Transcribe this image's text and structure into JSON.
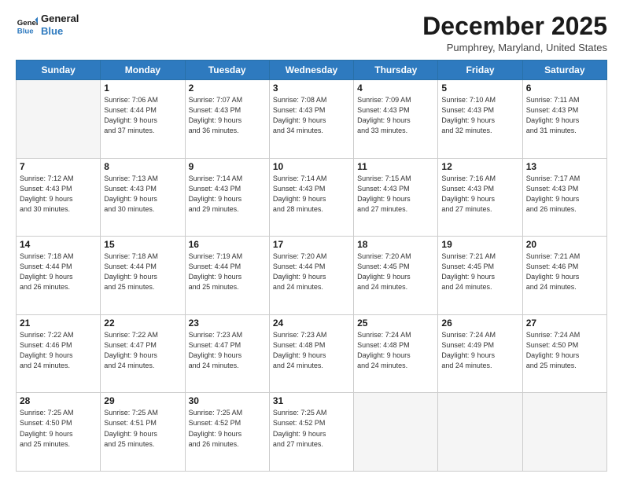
{
  "header": {
    "logo_line1": "General",
    "logo_line2": "Blue",
    "month": "December 2025",
    "location": "Pumphrey, Maryland, United States"
  },
  "days": [
    "Sunday",
    "Monday",
    "Tuesday",
    "Wednesday",
    "Thursday",
    "Friday",
    "Saturday"
  ],
  "weeks": [
    [
      {
        "day": "",
        "empty": true
      },
      {
        "day": "1",
        "sunrise": "7:06 AM",
        "sunset": "4:44 PM",
        "daylight": "9 hours and 37 minutes."
      },
      {
        "day": "2",
        "sunrise": "7:07 AM",
        "sunset": "4:43 PM",
        "daylight": "9 hours and 36 minutes."
      },
      {
        "day": "3",
        "sunrise": "7:08 AM",
        "sunset": "4:43 PM",
        "daylight": "9 hours and 34 minutes."
      },
      {
        "day": "4",
        "sunrise": "7:09 AM",
        "sunset": "4:43 PM",
        "daylight": "9 hours and 33 minutes."
      },
      {
        "day": "5",
        "sunrise": "7:10 AM",
        "sunset": "4:43 PM",
        "daylight": "9 hours and 32 minutes."
      },
      {
        "day": "6",
        "sunrise": "7:11 AM",
        "sunset": "4:43 PM",
        "daylight": "9 hours and 31 minutes."
      }
    ],
    [
      {
        "day": "7",
        "sunrise": "7:12 AM",
        "sunset": "4:43 PM",
        "daylight": "9 hours and 30 minutes."
      },
      {
        "day": "8",
        "sunrise": "7:13 AM",
        "sunset": "4:43 PM",
        "daylight": "9 hours and 30 minutes."
      },
      {
        "day": "9",
        "sunrise": "7:14 AM",
        "sunset": "4:43 PM",
        "daylight": "9 hours and 29 minutes."
      },
      {
        "day": "10",
        "sunrise": "7:14 AM",
        "sunset": "4:43 PM",
        "daylight": "9 hours and 28 minutes."
      },
      {
        "day": "11",
        "sunrise": "7:15 AM",
        "sunset": "4:43 PM",
        "daylight": "9 hours and 27 minutes."
      },
      {
        "day": "12",
        "sunrise": "7:16 AM",
        "sunset": "4:43 PM",
        "daylight": "9 hours and 27 minutes."
      },
      {
        "day": "13",
        "sunrise": "7:17 AM",
        "sunset": "4:43 PM",
        "daylight": "9 hours and 26 minutes."
      }
    ],
    [
      {
        "day": "14",
        "sunrise": "7:18 AM",
        "sunset": "4:44 PM",
        "daylight": "9 hours and 26 minutes."
      },
      {
        "day": "15",
        "sunrise": "7:18 AM",
        "sunset": "4:44 PM",
        "daylight": "9 hours and 25 minutes."
      },
      {
        "day": "16",
        "sunrise": "7:19 AM",
        "sunset": "4:44 PM",
        "daylight": "9 hours and 25 minutes."
      },
      {
        "day": "17",
        "sunrise": "7:20 AM",
        "sunset": "4:44 PM",
        "daylight": "9 hours and 24 minutes."
      },
      {
        "day": "18",
        "sunrise": "7:20 AM",
        "sunset": "4:45 PM",
        "daylight": "9 hours and 24 minutes."
      },
      {
        "day": "19",
        "sunrise": "7:21 AM",
        "sunset": "4:45 PM",
        "daylight": "9 hours and 24 minutes."
      },
      {
        "day": "20",
        "sunrise": "7:21 AM",
        "sunset": "4:46 PM",
        "daylight": "9 hours and 24 minutes."
      }
    ],
    [
      {
        "day": "21",
        "sunrise": "7:22 AM",
        "sunset": "4:46 PM",
        "daylight": "9 hours and 24 minutes."
      },
      {
        "day": "22",
        "sunrise": "7:22 AM",
        "sunset": "4:47 PM",
        "daylight": "9 hours and 24 minutes."
      },
      {
        "day": "23",
        "sunrise": "7:23 AM",
        "sunset": "4:47 PM",
        "daylight": "9 hours and 24 minutes."
      },
      {
        "day": "24",
        "sunrise": "7:23 AM",
        "sunset": "4:48 PM",
        "daylight": "9 hours and 24 minutes."
      },
      {
        "day": "25",
        "sunrise": "7:24 AM",
        "sunset": "4:48 PM",
        "daylight": "9 hours and 24 minutes."
      },
      {
        "day": "26",
        "sunrise": "7:24 AM",
        "sunset": "4:49 PM",
        "daylight": "9 hours and 24 minutes."
      },
      {
        "day": "27",
        "sunrise": "7:24 AM",
        "sunset": "4:50 PM",
        "daylight": "9 hours and 25 minutes."
      }
    ],
    [
      {
        "day": "28",
        "sunrise": "7:25 AM",
        "sunset": "4:50 PM",
        "daylight": "9 hours and 25 minutes."
      },
      {
        "day": "29",
        "sunrise": "7:25 AM",
        "sunset": "4:51 PM",
        "daylight": "9 hours and 25 minutes."
      },
      {
        "day": "30",
        "sunrise": "7:25 AM",
        "sunset": "4:52 PM",
        "daylight": "9 hours and 26 minutes."
      },
      {
        "day": "31",
        "sunrise": "7:25 AM",
        "sunset": "4:52 PM",
        "daylight": "9 hours and 27 minutes."
      },
      {
        "day": "",
        "empty": true
      },
      {
        "day": "",
        "empty": true
      },
      {
        "day": "",
        "empty": true
      }
    ]
  ]
}
